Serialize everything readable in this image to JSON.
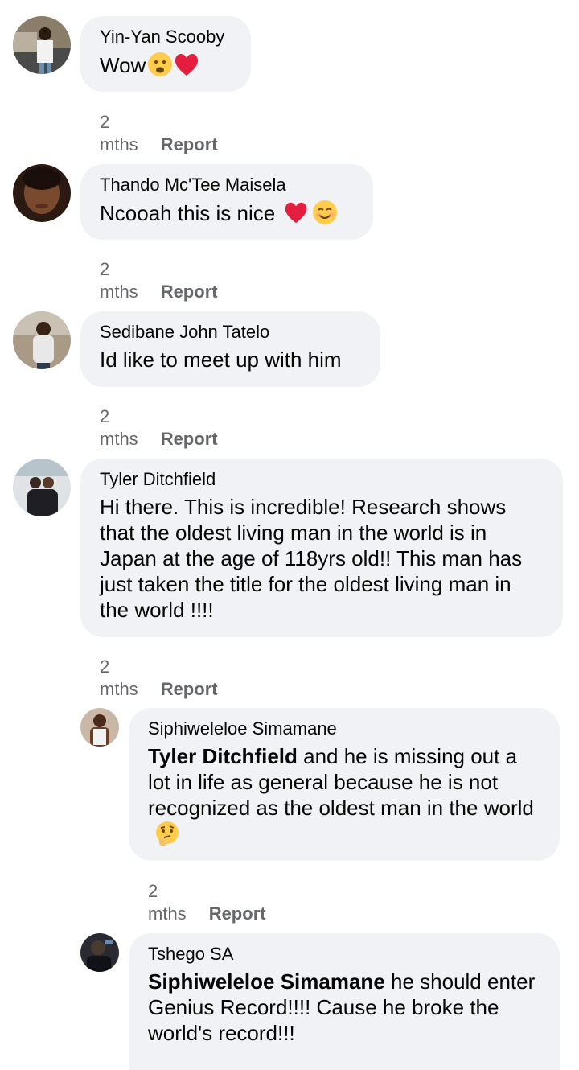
{
  "comments": [
    {
      "author": "Yin-Yan Scooby",
      "text": "Wow",
      "time": "2 mths",
      "report": "Report",
      "emojis": [
        "frowning-face-emoji",
        "red-heart-emoji"
      ]
    },
    {
      "author": "Thando Mc'Tee Maisela",
      "text": "Ncooah this is nice",
      "time": "2 mths",
      "report": "Report",
      "emojis": [
        "red-heart-emoji",
        "smiling-face-emoji"
      ]
    },
    {
      "author": "Sedibane John Tatelo",
      "text": "Id like to meet up with him",
      "time": "2 mths",
      "report": "Report"
    },
    {
      "author": "Tyler Ditchfield",
      "text": "Hi there. This is incredible! Research shows that the oldest living man in the world is in Japan at the age of 118yrs old!! This man has just taken the title for the oldest living man in the world !!!!",
      "time": "2 mths",
      "report": "Report"
    }
  ],
  "replies": [
    {
      "author": "Siphiweleloe Simamane",
      "mention": "Tyler Ditchfield",
      "text": " and he is missing out a lot in life as general because he is not recognized as the oldest man in the world",
      "time": "2 mths",
      "report": "Report",
      "emojis": [
        "thinking-face-emoji"
      ]
    },
    {
      "author": "Tshego SA",
      "mention": "Siphiweleloe Simamane",
      "text": " he should enter Genius Record!!!! Cause he broke the world's record!!!"
    }
  ],
  "colors": {
    "bubble": "#f0f2f5",
    "meta_text": "#65676b",
    "body_text": "#050505",
    "heart": "#e41e3f",
    "emoji_face": "#ffcc4d"
  }
}
